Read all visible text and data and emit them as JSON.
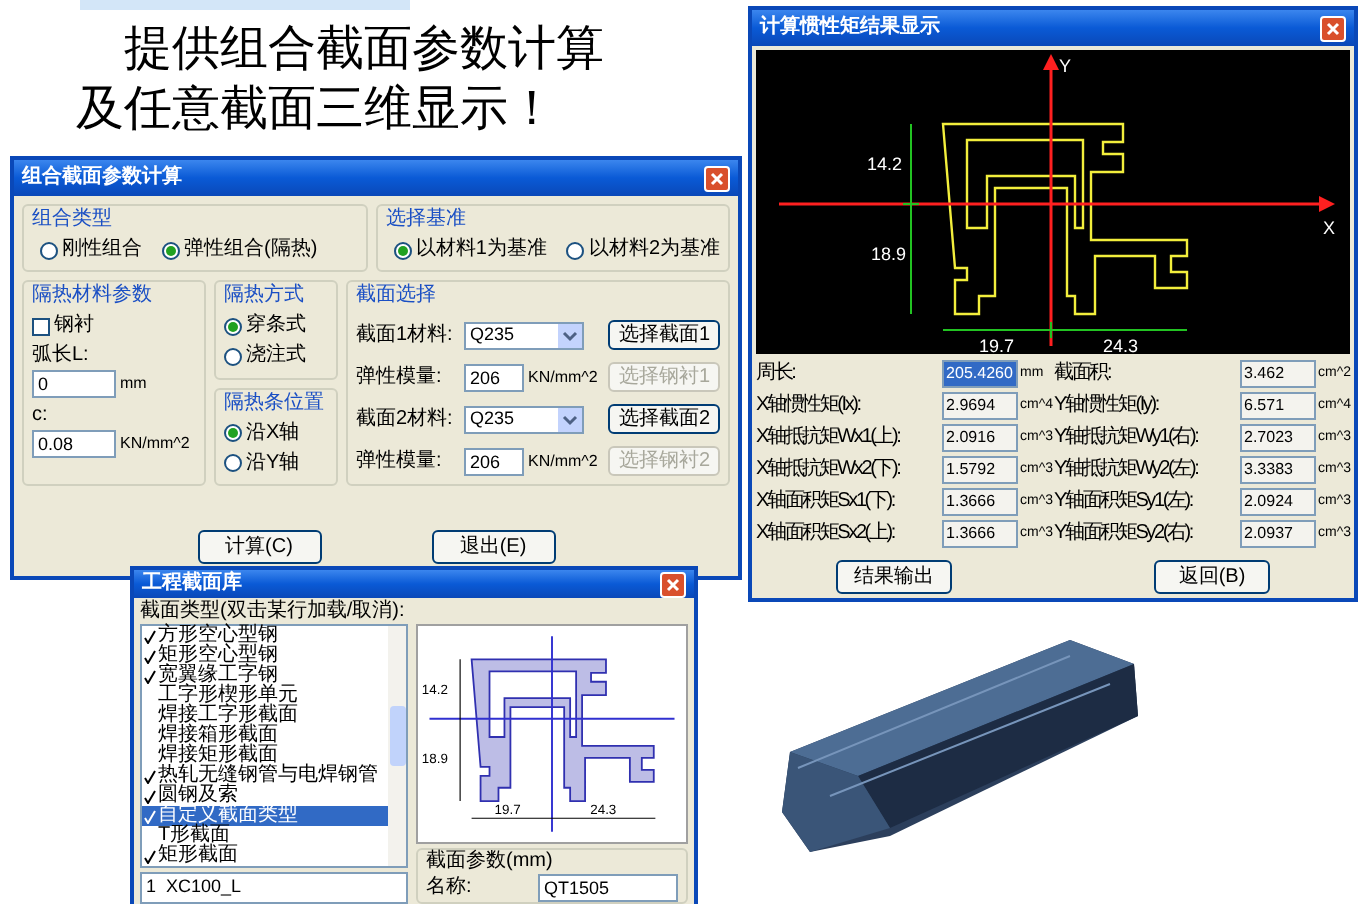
{
  "headline": [
    "提供组合截面参数计算",
    "及任意截面三维显示！"
  ],
  "combo_dialog": {
    "title": "组合截面参数计算",
    "combo_type": {
      "label": "组合类型",
      "options": [
        {
          "label": "刚性组合",
          "selected": false
        },
        {
          "label": "弹性组合(隔热)",
          "selected": true
        }
      ]
    },
    "baseline": {
      "label": "选择基准",
      "options": [
        {
          "label": "以材料1为基准",
          "selected": true
        },
        {
          "label": "以材料2为基准",
          "selected": false
        }
      ]
    },
    "insulation_params": {
      "label": "隔热材料参数",
      "steel_liner": {
        "label": "钢衬",
        "checked": false
      },
      "fields": [
        {
          "label": "弧长L:",
          "value": "0",
          "unit": "mm"
        },
        {
          "label": "c:",
          "value": "0.08",
          "unit": "KN/mm^2"
        }
      ]
    },
    "insulation_method": {
      "label": "隔热方式",
      "options": [
        {
          "label": "穿条式",
          "selected": true
        },
        {
          "label": "浇注式",
          "selected": false
        }
      ]
    },
    "strip_position": {
      "label": "隔热条位置",
      "options": [
        {
          "label": "沿X轴",
          "selected": true
        },
        {
          "label": "沿Y轴",
          "selected": false
        }
      ]
    },
    "section_select": {
      "label": "截面选择",
      "rows": [
        {
          "kind": "select",
          "label": "截面1材料:",
          "value": "Q235",
          "button": {
            "label": "选择截面1",
            "disabled": false
          }
        },
        {
          "kind": "input",
          "label": "弹性模量:",
          "value": "206",
          "unit": "KN/mm^2",
          "button": {
            "label": "选择钢衬1",
            "disabled": true
          }
        },
        {
          "kind": "select",
          "label": "截面2材料:",
          "value": "Q235",
          "button": {
            "label": "选择截面2",
            "disabled": false
          }
        },
        {
          "kind": "input",
          "label": "弹性模量:",
          "value": "206",
          "unit": "KN/mm^2",
          "button": {
            "label": "选择钢衬2",
            "disabled": true
          }
        }
      ]
    },
    "buttons": [
      "计算(C)",
      "退出(E)"
    ]
  },
  "result_dialog": {
    "title": "计算惯性矩结果显示",
    "drawing": {
      "axis_x": "X",
      "axis_y": "Y",
      "dims": [
        "14.2",
        "18.9",
        "19.7",
        "24.3"
      ]
    },
    "results": [
      {
        "label": "周长:",
        "value": "205.4260",
        "unit": "mm",
        "selected": true
      },
      {
        "label": "截面积:",
        "value": "3.462",
        "unit": "cm^2",
        "selected": false
      },
      {
        "label": "X轴惯性矩(Ix):",
        "value": "2.9694",
        "unit": "cm^4",
        "selected": false
      },
      {
        "label": "Y轴惯性矩(Iy):",
        "value": "6.571",
        "unit": "cm^4",
        "selected": false
      },
      {
        "label": "X轴抵抗矩Wx1(上):",
        "value": "2.0916",
        "unit": "cm^3",
        "selected": false
      },
      {
        "label": "Y轴抵抗矩Wy1(右):",
        "value": "2.7023",
        "unit": "cm^3",
        "selected": false
      },
      {
        "label": "X轴抵抗矩Wx2(下):",
        "value": "1.5792",
        "unit": "cm^3",
        "selected": false
      },
      {
        "label": "Y轴抵抗矩Wy2(左):",
        "value": "3.3383",
        "unit": "cm^3",
        "selected": false
      },
      {
        "label": "X轴面积矩Sx1(下):",
        "value": "1.3666",
        "unit": "cm^3",
        "selected": false
      },
      {
        "label": "Y轴面积矩Sy1(左):",
        "value": "2.0924",
        "unit": "cm^3",
        "selected": false
      },
      {
        "label": "X轴面积矩Sx2(上):",
        "value": "1.3666",
        "unit": "cm^3",
        "selected": false
      },
      {
        "label": "Y轴面积矩Sy2(右):",
        "value": "2.0937",
        "unit": "cm^3",
        "selected": false
      }
    ],
    "buttons": [
      "结果输出",
      "返回(B)"
    ]
  },
  "library_dialog": {
    "title": "工程截面库",
    "list_label": "截面类型(双击某行加载/取消):",
    "types": [
      {
        "label": "方形空心型钢",
        "checked": true,
        "selected": false
      },
      {
        "label": "矩形空心型钢",
        "checked": true,
        "selected": false
      },
      {
        "label": "宽翼缘工字钢",
        "checked": true,
        "selected": false
      },
      {
        "label": "工字形楔形单元",
        "checked": false,
        "selected": false
      },
      {
        "label": "焊接工字形截面",
        "checked": false,
        "selected": false
      },
      {
        "label": "焊接箱形截面",
        "checked": false,
        "selected": false
      },
      {
        "label": "焊接矩形截面",
        "checked": false,
        "selected": false
      },
      {
        "label": "热轧无缝钢管与电焊钢管",
        "checked": true,
        "selected": false
      },
      {
        "label": "圆钢及索",
        "checked": true,
        "selected": false
      },
      {
        "label": "自定义截面类型",
        "checked": true,
        "selected": true
      },
      {
        "label": "T形截面",
        "checked": false,
        "selected": false
      },
      {
        "label": "矩形截面",
        "checked": true,
        "selected": false
      }
    ],
    "loaded": [
      "1  XC100_L"
    ],
    "drawing": {
      "dims": [
        "14.2",
        "18.9",
        "19.7",
        "24.3"
      ]
    },
    "params_label": "截面参数(mm)",
    "name_label": "名称:",
    "name_value": "QT1505"
  }
}
